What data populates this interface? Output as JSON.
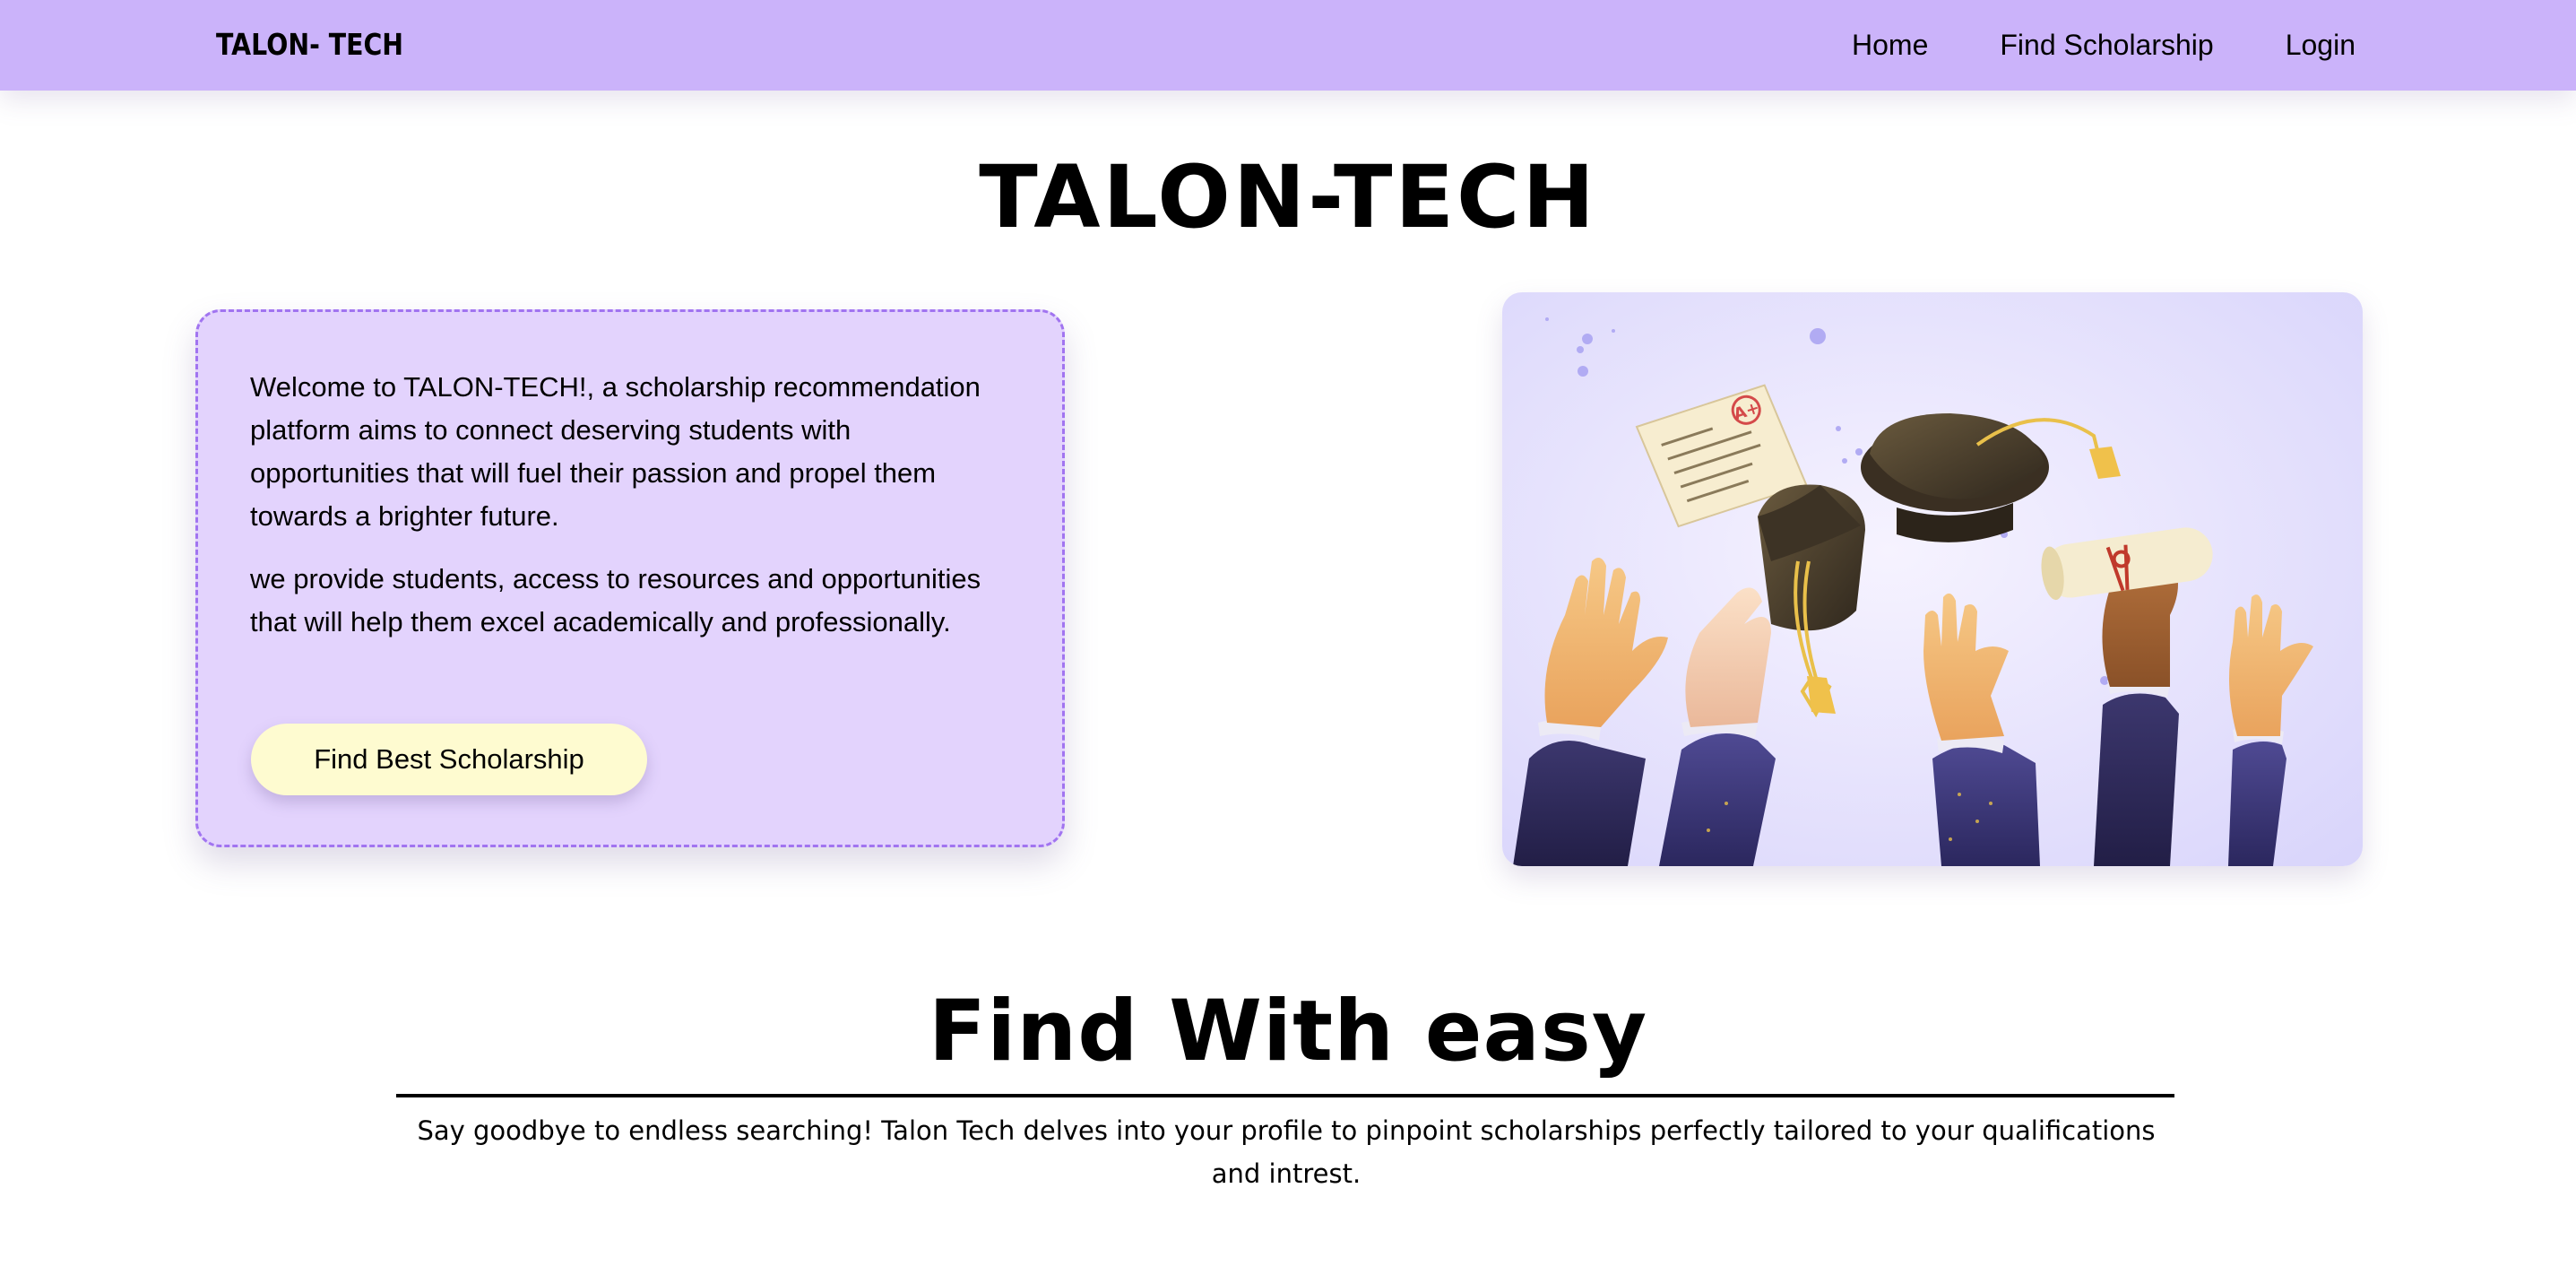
{
  "navbar": {
    "brand": "TALON- TECH",
    "links": [
      "Home",
      "Find Scholarship",
      "Login"
    ]
  },
  "hero": {
    "title": "TALON-TECH",
    "paragraph_1": "Welcome to TALON-TECH!, a scholarship recommendation platform aims to connect deserving students with opportunities that will fuel their passion and propel them towards a brighter future.",
    "paragraph_2": "we provide students, access to resources and opportunities that will help them excel academically and professionally.",
    "cta_label": "Find Best Scholarship",
    "illustration": {
      "icon": "graduation-celebration-illustration",
      "paper_grade": "A+"
    }
  },
  "feature": {
    "title": "Find With easy",
    "description": "Say goodbye to endless searching! Talon Tech delves into your profile to pinpoint scholarships perfectly tailored to your qualifications and intrest."
  },
  "colors": {
    "navbar_bg": "#cbb3fa",
    "card_bg": "#e3d3fd",
    "card_border": "#a174f0",
    "button_bg": "#fefbd0",
    "illustration_bg": "#e2dffd"
  }
}
